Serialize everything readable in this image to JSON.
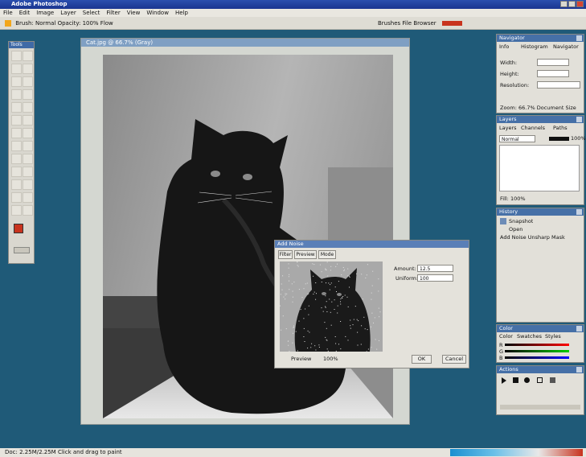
{
  "window": {
    "title": "Adobe Photoshop"
  },
  "menu": {
    "items": [
      "File",
      "Edit",
      "Image",
      "Layer",
      "Select",
      "Filter",
      "View",
      "Window",
      "Help"
    ]
  },
  "options": {
    "tool_text": "Brush: Normal  Opacity: 100%  Flow",
    "right_text": "Brushes  File Browser"
  },
  "toolbox": {
    "title": "Tools"
  },
  "document": {
    "title": "Cat.jpg @ 66.7% (Gray)"
  },
  "dialog": {
    "title": "Add Noise",
    "tabs": [
      "Filter",
      "Preview",
      "Mode"
    ],
    "amount_label": "Amount:",
    "amount_value": "12.5",
    "distribution_label": "Uniform:",
    "distribution_value": "100",
    "preview_label": "Preview",
    "zoom_value": "100%",
    "ok": "OK",
    "cancel": "Cancel"
  },
  "navigator": {
    "title": "Navigator",
    "tabs": [
      "Info",
      "Histogram",
      "Navigator"
    ],
    "rows": [
      "Width:",
      "Height:",
      "Resolution:"
    ],
    "footer": "Zoom: 66.7%   Document Size"
  },
  "layers": {
    "title": "Layers",
    "tabs": [
      "Layers",
      "Channels",
      "Paths"
    ],
    "blend": "Normal",
    "opacity": "100%",
    "footer": "Fill: 100%"
  },
  "history": {
    "title": "History",
    "items": [
      "Snapshot",
      "Open",
      "Add Noise Unsharp Mask"
    ]
  },
  "color": {
    "title": "Color",
    "tabs": [
      "Color",
      "Swatches",
      "Styles"
    ],
    "channels": [
      "R",
      "G",
      "B"
    ]
  },
  "actions": {
    "title": "Actions"
  },
  "status": {
    "text": "Doc: 2.25M/2.25M   Click and drag to paint"
  },
  "colors": {
    "title_bar": "#2b4fae",
    "desktop": "#1f5a78",
    "panel_title": "#4670a7",
    "foreground": "#c8331e"
  }
}
